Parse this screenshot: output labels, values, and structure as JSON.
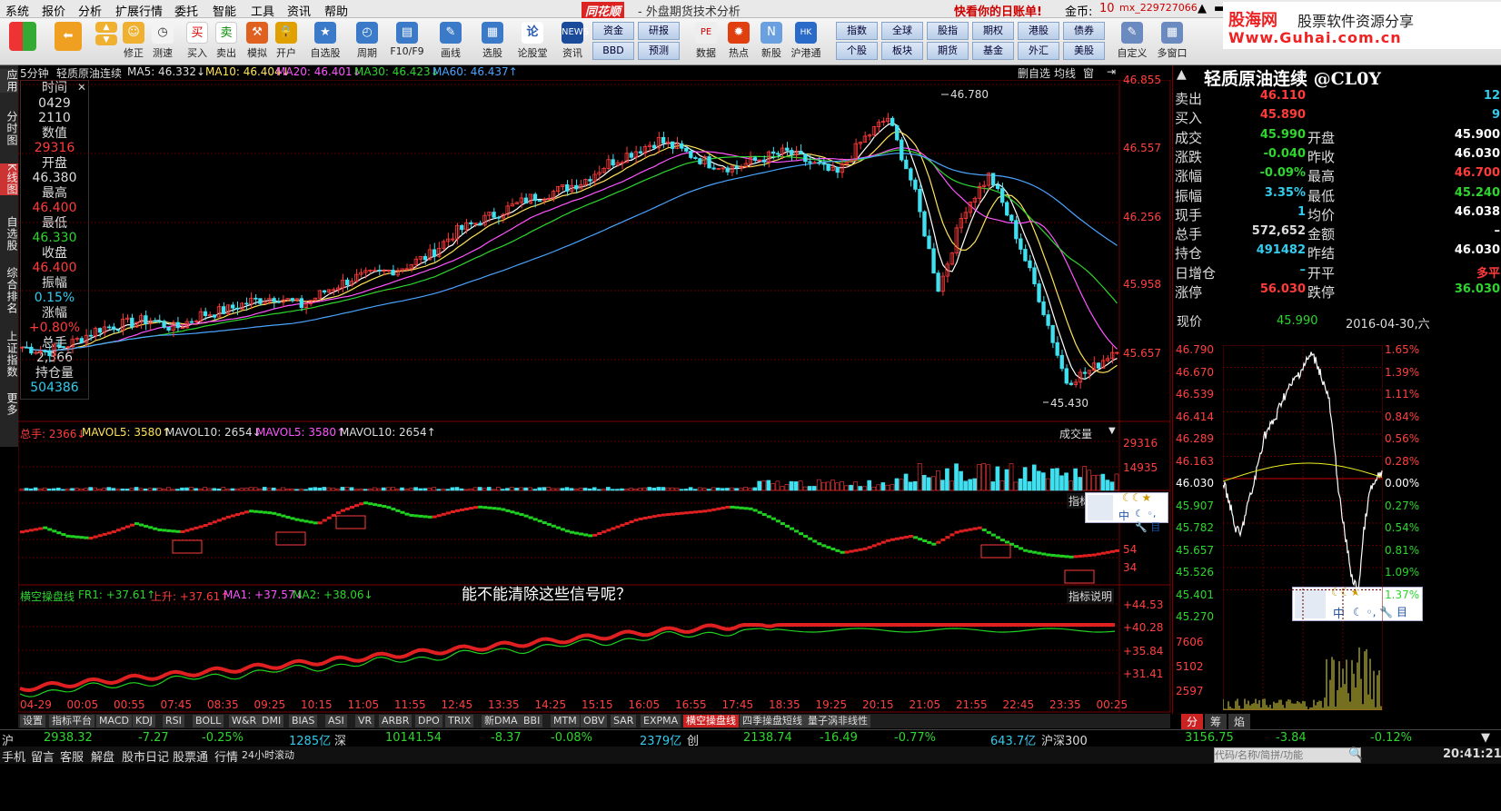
{
  "menu": [
    "系统",
    "报价",
    "分析",
    "扩展行情",
    "委托",
    "智能",
    "工具",
    "资讯",
    "帮助"
  ],
  "app_brand": "同花顺",
  "window_title": "- 外盘期货技术分析",
  "promo": "快看你的日账单!",
  "gold_label": "金币:",
  "gold_value": "10",
  "username": "mx_229727066",
  "site_brand": "股海网",
  "site_slogan": "股票软件资源分享",
  "site_url": "Www.Guhai.com.cn",
  "toolbar": [
    "",
    "",
    "修正",
    "测速",
    "买入",
    "卖出",
    "模拟",
    "开户",
    "自选股",
    "周期",
    "F10/F9",
    "画线",
    "选股",
    "论股堂",
    "资讯",
    "",
    "",
    "数据",
    "热点",
    "新股",
    "沪港通",
    "",
    "",
    "",
    "",
    "自定义",
    "多窗口"
  ],
  "toolgrid": [
    "资金",
    "研报",
    "BBD",
    "预测",
    "指数",
    "全球",
    "股指",
    "期权",
    "港股",
    "债券",
    "个股",
    "板块",
    "期货",
    "基金",
    "外汇",
    "美股"
  ],
  "leftnav": [
    "应用",
    "分时图",
    "K线图",
    "自选股",
    "综合排名",
    "上证指数",
    "更多"
  ],
  "chart_header": {
    "period": "5分钟",
    "name": "轻质原油连续",
    "ma5": "MA5: 46.332↓",
    "ma10": "MA10: 46.404↓",
    "ma20": "MA20: 46.401↓",
    "ma30": "MA30: 46.423↓",
    "ma60": "MA60: 46.437↑",
    "tools": [
      "删自选",
      "均线",
      "窗"
    ]
  },
  "info_box": [
    "时间",
    "0429",
    "2110",
    "数值",
    "29316",
    "开盘",
    "46.380",
    "最高",
    "46.400",
    "最低",
    "46.330",
    "收盘",
    "46.400",
    "振幅",
    "0.15%",
    "涨幅",
    "+0.80%",
    "总手",
    "2,366",
    "持仓量",
    "504386"
  ],
  "price_axis": [
    "46.855",
    "46.557",
    "46.256",
    "45.958",
    "45.657"
  ],
  "high_label": "46.780",
  "low_label": "45.430",
  "vol_header": {
    "a": "总手: 2366↓",
    "b": "MAVOL5: 3580↑",
    "c": "MAVOL10: 2654↓",
    "d": "MAVOL5: 3580↑",
    "e": "MAVOL10: 2654↑"
  },
  "vol_selector": "成交量",
  "vol_axis": [
    "29316",
    "14935"
  ],
  "ind_axis": [
    "74",
    "54",
    "34"
  ],
  "indicator_help": "指标说明",
  "annotation": "能不能清除这些信号呢？",
  "ind2_header": {
    "name": "横空操盘线",
    "fr1": "FR1: +37.61↑",
    "up": "上升: +37.61↑",
    "ma1": "MA1: +37.57↓",
    "ma2": "MA2: +38.06↓"
  },
  "ind2_axis": [
    "+44.53",
    "+40.28",
    "+35.84",
    "+31.41"
  ],
  "time_axis": [
    "04-29",
    "00:05",
    "00:55",
    "07:45",
    "08:35",
    "09:25",
    "10:15",
    "11:05",
    "11:55",
    "12:45",
    "13:35",
    "14:25",
    "15:15",
    "16:05",
    "16:55",
    "17:45",
    "18:35",
    "19:25",
    "20:15",
    "21:05",
    "21:55",
    "22:45",
    "23:35",
    "00:25"
  ],
  "bottom_tabs": [
    "设置",
    "指标平台",
    "MACD",
    "KDJ",
    "RSI",
    "BOLL",
    "W&R",
    "DMI",
    "BIAS",
    "ASI",
    "VR",
    "ARBR",
    "DPO",
    "TRIX",
    "新DMA",
    "BBI",
    "MTM",
    "OBV",
    "SAR",
    "EXPMA",
    "横空操盘线",
    "四季操盘短线",
    "量子涡非线性"
  ],
  "quote": {
    "title": "轻质原油连续 @CL0Y",
    "rows": [
      [
        "卖出",
        "46.110",
        "",
        "12"
      ],
      [
        "买入",
        "45.890",
        "",
        "9"
      ],
      [
        "成交",
        "45.990",
        "开盘",
        "45.900"
      ],
      [
        "涨跌",
        "-0.040",
        "昨收",
        "46.030"
      ],
      [
        "涨幅",
        "-0.09%",
        "最高",
        "46.700"
      ],
      [
        "振幅",
        "3.35%",
        "最低",
        "45.240"
      ],
      [
        "现手",
        "1",
        "均价",
        "46.038"
      ],
      [
        "总手",
        "572,652",
        "金额",
        "–"
      ],
      [
        "持仓",
        "491482",
        "昨结",
        "46.030"
      ],
      [
        "日增仓",
        "–",
        "开平",
        "多平"
      ],
      [
        "涨停",
        "56.030",
        "跌停",
        "36.030"
      ]
    ],
    "now_label": "现价",
    "now_value": "45.990",
    "date": "2016-04-30,六"
  },
  "mini_axis_left": [
    "46.790",
    "46.670",
    "46.539",
    "46.414",
    "46.289",
    "46.163",
    "46.030",
    "45.907",
    "45.782",
    "45.657",
    "45.526",
    "45.401",
    "45.270",
    "7606",
    "5102",
    "2597"
  ],
  "mini_axis_right": [
    "1.65%",
    "1.39%",
    "1.11%",
    "0.84%",
    "0.56%",
    "0.28%",
    "0.00%",
    "0.27%",
    "0.54%",
    "0.81%",
    "1.09%",
    "1.37%"
  ],
  "right_tabs": [
    "分",
    "筹",
    "焰"
  ],
  "ime": {
    "lang": "中",
    "items": [
      "☾",
      "◦,",
      "🔧",
      "目"
    ]
  },
  "status1": [
    "沪",
    "2938.32",
    "-7.27",
    "-0.25%",
    "1285亿",
    "深",
    "10141.54",
    "-8.37",
    "-0.08%",
    "2379亿",
    "创",
    "2138.74",
    "-16.49",
    "-0.77%",
    "643.7亿",
    "沪深300",
    "3156.75",
    "-3.84",
    "-0.12%"
  ],
  "status2": [
    "手机",
    "留言",
    "客服",
    "解盘",
    "股市日记",
    "股票通",
    "行情",
    "24小时滚动"
  ],
  "search_placeholder": "代码/名称/简拼/功能",
  "clock": "20:41:21",
  "chart_data": {
    "type": "candlestick",
    "title": "轻质原油连续",
    "ylim": [
      45.43,
      46.855
    ],
    "high": 46.78,
    "low": 45.43,
    "close_path": [
      45.7,
      45.68,
      45.72,
      45.78,
      45.8,
      45.82,
      45.78,
      45.84,
      45.86,
      45.9,
      45.92,
      45.88,
      45.95,
      46.0,
      46.02,
      46.05,
      46.1,
      46.2,
      46.25,
      46.3,
      46.35,
      46.38,
      46.42,
      46.5,
      46.55,
      46.6,
      46.55,
      46.5,
      46.48,
      46.52,
      46.55,
      46.5,
      46.45,
      46.6,
      46.7,
      46.4,
      45.95,
      46.3,
      46.45,
      46.2,
      45.9,
      45.55,
      45.6,
      45.7
    ]
  }
}
